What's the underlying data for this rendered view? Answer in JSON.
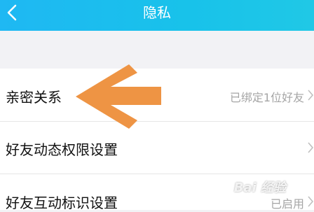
{
  "header": {
    "title": "隐私",
    "back_icon": "chevron-left-icon"
  },
  "rows": [
    {
      "label": "亲密关系",
      "value": "已绑定1位好友"
    },
    {
      "label": "好友动态权限设置",
      "value": ""
    },
    {
      "label": "好友互动标识设置",
      "value": "已启用"
    }
  ],
  "annotation": {
    "type": "arrow-left",
    "color": "#ee9444"
  },
  "watermark": {
    "text": "Bai 经验"
  },
  "colors": {
    "header": "#1fb8f3",
    "background": "#f2f2f5",
    "value_text": "#a5a5a5"
  }
}
